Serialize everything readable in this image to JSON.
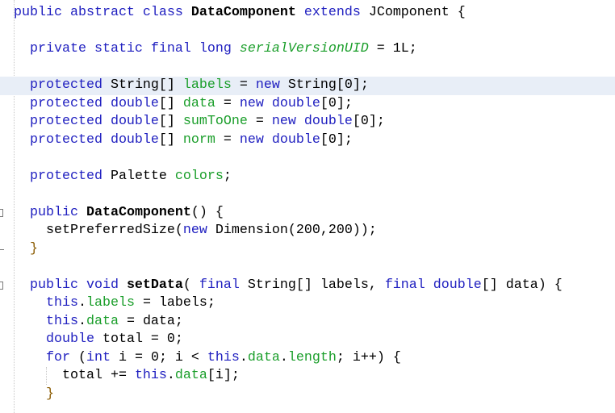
{
  "editor": {
    "language": "java",
    "current_line_index": 4,
    "colors": {
      "keyword": "#2020c0",
      "field": "#1a9e2a",
      "current_line": "#e8eef7",
      "text": "#000000"
    },
    "lines": [
      {
        "tokens": [
          {
            "t": "public abstract class ",
            "c": "kw"
          },
          {
            "t": "DataComponent",
            "c": "bold"
          },
          {
            "t": " extends ",
            "c": "kw"
          },
          {
            "t": "JComponent {",
            "c": "plain"
          }
        ]
      },
      {
        "tokens": []
      },
      {
        "tokens": [
          {
            "t": "  private static final long ",
            "c": "kw"
          },
          {
            "t": "serialVersionUID",
            "c": "static-field"
          },
          {
            "t": " = 1L;",
            "c": "plain"
          }
        ]
      },
      {
        "tokens": []
      },
      {
        "tokens": [
          {
            "t": "  protected ",
            "c": "kw"
          },
          {
            "t": "String[] ",
            "c": "plain"
          },
          {
            "t": "labels",
            "c": "field"
          },
          {
            "t": " = ",
            "c": "plain"
          },
          {
            "t": "new ",
            "c": "kw"
          },
          {
            "t": "String[0];",
            "c": "plain"
          }
        ]
      },
      {
        "tokens": [
          {
            "t": "  protected double",
            "c": "kw"
          },
          {
            "t": "[] ",
            "c": "plain"
          },
          {
            "t": "data",
            "c": "field"
          },
          {
            "t": " = ",
            "c": "plain"
          },
          {
            "t": "new double",
            "c": "kw"
          },
          {
            "t": "[0];",
            "c": "plain"
          }
        ]
      },
      {
        "tokens": [
          {
            "t": "  protected double",
            "c": "kw"
          },
          {
            "t": "[] ",
            "c": "plain"
          },
          {
            "t": "sumToOne",
            "c": "field"
          },
          {
            "t": " = ",
            "c": "plain"
          },
          {
            "t": "new double",
            "c": "kw"
          },
          {
            "t": "[0];",
            "c": "plain"
          }
        ]
      },
      {
        "tokens": [
          {
            "t": "  protected double",
            "c": "kw"
          },
          {
            "t": "[] ",
            "c": "plain"
          },
          {
            "t": "norm",
            "c": "field"
          },
          {
            "t": " = ",
            "c": "plain"
          },
          {
            "t": "new double",
            "c": "kw"
          },
          {
            "t": "[0];",
            "c": "plain"
          }
        ]
      },
      {
        "tokens": []
      },
      {
        "tokens": [
          {
            "t": "  protected ",
            "c": "kw"
          },
          {
            "t": "Palette ",
            "c": "plain"
          },
          {
            "t": "colors",
            "c": "field"
          },
          {
            "t": ";",
            "c": "plain"
          }
        ]
      },
      {
        "tokens": []
      },
      {
        "tokens": [
          {
            "t": "  public ",
            "c": "kw"
          },
          {
            "t": "DataComponent",
            "c": "bold"
          },
          {
            "t": "() {",
            "c": "plain"
          }
        ]
      },
      {
        "tokens": [
          {
            "t": "    setPreferredSize(",
            "c": "plain"
          },
          {
            "t": "new ",
            "c": "kw"
          },
          {
            "t": "Dimension(200,200));",
            "c": "plain"
          }
        ]
      },
      {
        "tokens": [
          {
            "t": "  }",
            "c": "brace-brown"
          }
        ]
      },
      {
        "tokens": []
      },
      {
        "tokens": [
          {
            "t": "  public void ",
            "c": "kw"
          },
          {
            "t": "setData",
            "c": "bold"
          },
          {
            "t": "( ",
            "c": "plain"
          },
          {
            "t": "final ",
            "c": "kw"
          },
          {
            "t": "String[] labels, ",
            "c": "plain"
          },
          {
            "t": "final double",
            "c": "kw"
          },
          {
            "t": "[] data) {",
            "c": "plain"
          }
        ]
      },
      {
        "tokens": [
          {
            "t": "    this",
            "c": "kw"
          },
          {
            "t": ".",
            "c": "plain"
          },
          {
            "t": "labels",
            "c": "field"
          },
          {
            "t": " = labels;",
            "c": "plain"
          }
        ]
      },
      {
        "tokens": [
          {
            "t": "    this",
            "c": "kw"
          },
          {
            "t": ".",
            "c": "plain"
          },
          {
            "t": "data",
            "c": "field"
          },
          {
            "t": " = data;",
            "c": "plain"
          }
        ]
      },
      {
        "tokens": [
          {
            "t": "    double",
            "c": "kw"
          },
          {
            "t": " total = 0;",
            "c": "plain"
          }
        ]
      },
      {
        "tokens": [
          {
            "t": "    for ",
            "c": "kw"
          },
          {
            "t": "(",
            "c": "plain"
          },
          {
            "t": "int",
            "c": "kw"
          },
          {
            "t": " i = 0; i < ",
            "c": "plain"
          },
          {
            "t": "this",
            "c": "kw"
          },
          {
            "t": ".",
            "c": "plain"
          },
          {
            "t": "data",
            "c": "field"
          },
          {
            "t": ".",
            "c": "plain"
          },
          {
            "t": "length",
            "c": "field"
          },
          {
            "t": "; i++) {",
            "c": "plain"
          }
        ]
      },
      {
        "tokens": [
          {
            "t": "      total += ",
            "c": "plain"
          },
          {
            "t": "this",
            "c": "kw"
          },
          {
            "t": ".",
            "c": "plain"
          },
          {
            "t": "data",
            "c": "field"
          },
          {
            "t": "[i];",
            "c": "plain"
          }
        ]
      },
      {
        "tokens": [
          {
            "t": "    }",
            "c": "brace-brown"
          }
        ]
      }
    ],
    "fold_markers": [
      {
        "line_index": 11,
        "type": "collapse"
      },
      {
        "line_index": 13,
        "type": "end"
      },
      {
        "line_index": 15,
        "type": "collapse"
      }
    ]
  }
}
